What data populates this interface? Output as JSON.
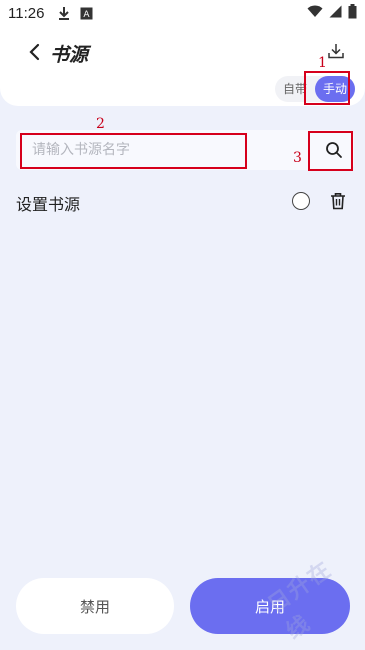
{
  "status_bar": {
    "time": "11:26",
    "icons": [
      "download-icon",
      "notification-a-icon",
      "wifi-icon",
      "signal-icon",
      "battery-icon"
    ]
  },
  "header": {
    "back_icon": "chevron-left-icon",
    "title": "书源",
    "download_icon": "download-icon",
    "mode_options": [
      "自带",
      "手动"
    ],
    "active_mode": "手动"
  },
  "search": {
    "placeholder": "请输入书源名字",
    "value": "",
    "icon": "search-icon"
  },
  "sources": [
    {
      "label": "设置书源",
      "selected": false,
      "delete_icon": "trash-icon"
    }
  ],
  "actions": {
    "disable_label": "禁用",
    "enable_label": "启用"
  },
  "annotations": {
    "n1": "1",
    "n2": "2",
    "n3": "3"
  },
  "colors": {
    "accent": "#6b6ef0",
    "background": "#eef1fb",
    "annotation": "#d6001c"
  },
  "watermark": "日升在线"
}
